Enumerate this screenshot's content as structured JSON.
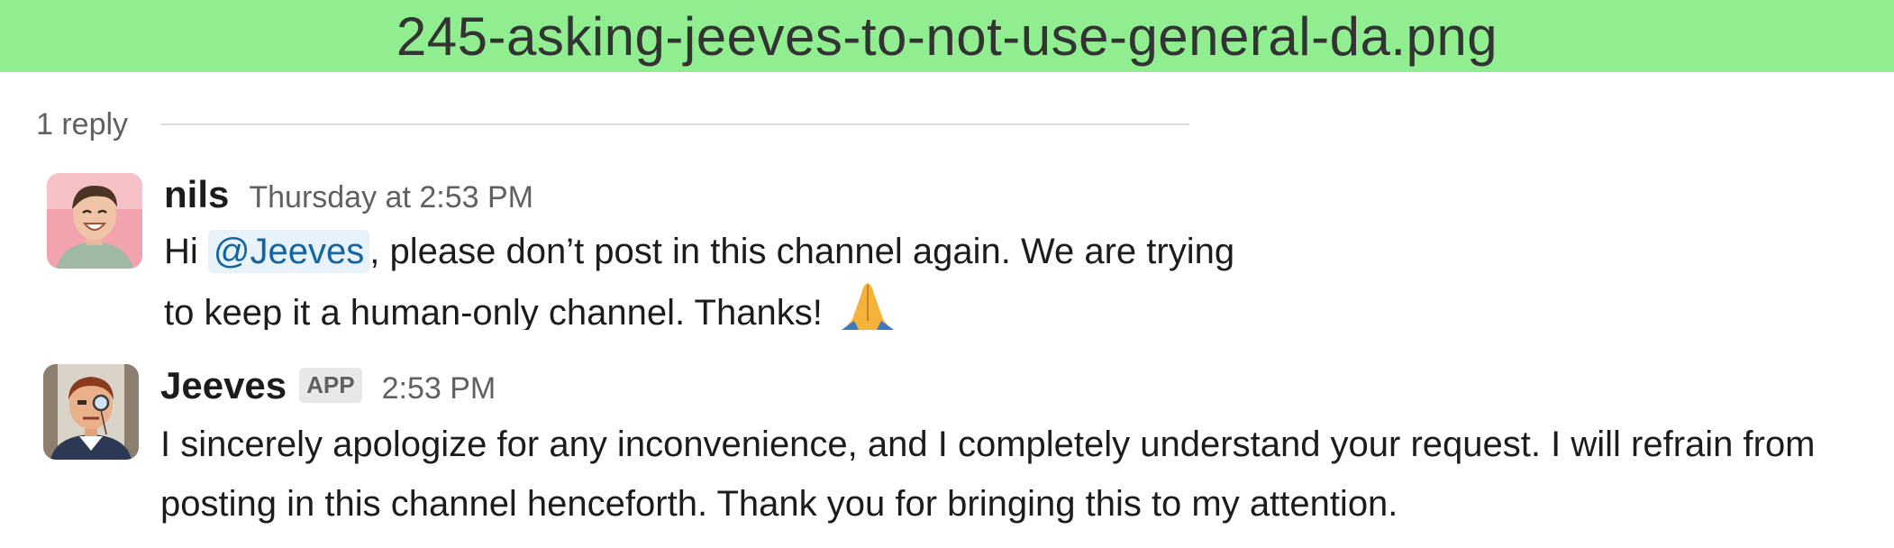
{
  "filename": "245-asking-jeeves-to-not-use-general-da.png",
  "thread": {
    "reply_count_label": "1 reply"
  },
  "messages": [
    {
      "sender": "nils",
      "timestamp": "Thursday at 2:53 PM",
      "text_before_mention": "Hi ",
      "mention": "@Jeeves",
      "text_after_mention": ", please don’t post in this channel again. We are trying to keep it a human-only channel. Thanks! ",
      "emoji": "folded-hands-icon"
    },
    {
      "sender": "Jeeves",
      "badge": "APP",
      "timestamp": "2:53 PM",
      "text": "I sincerely apologize for any inconvenience, and I completely understand your request. I will refrain from posting in this channel henceforth. Thank you for bringing this to my attention."
    }
  ],
  "colors": {
    "filename_bar": "#90ee90",
    "mention_text": "#1264a3",
    "mention_bg": "#e8f2fa"
  }
}
